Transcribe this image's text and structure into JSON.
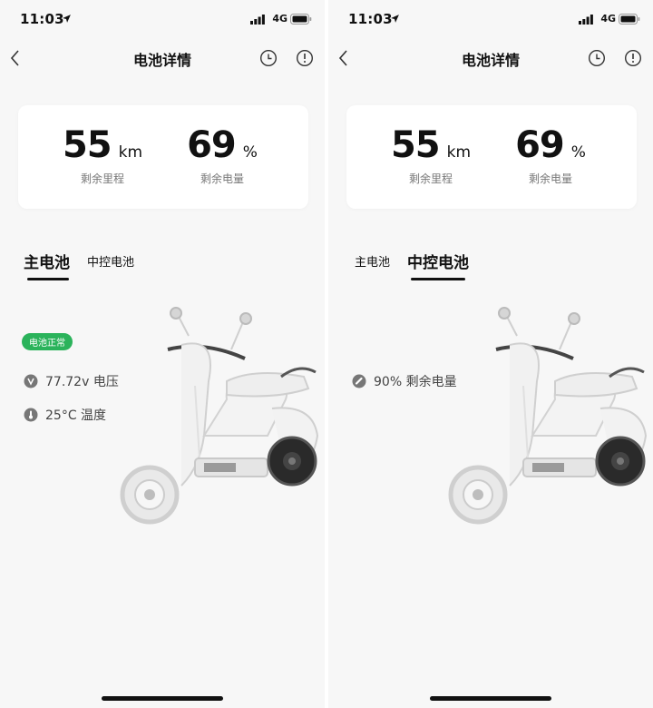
{
  "status_bar": {
    "time": "11:03",
    "network": "4G"
  },
  "header": {
    "title": "电池详情"
  },
  "summary": {
    "range_value": "55",
    "range_unit": "km",
    "range_label": "剩余里程",
    "soc_value": "69",
    "soc_unit": "%",
    "soc_label": "剩余电量"
  },
  "tabs": [
    {
      "label": "主电池"
    },
    {
      "label": "中控电池"
    }
  ],
  "main_battery": {
    "status_badge": "电池正常",
    "voltage": "77.72v 电压",
    "temperature": "25°C 温度"
  },
  "control_battery": {
    "remaining": "90% 剩余电量"
  },
  "colors": {
    "accent_green": "#2bb35b",
    "card_bg": "#ffffff",
    "page_bg": "#f7f7f7"
  }
}
